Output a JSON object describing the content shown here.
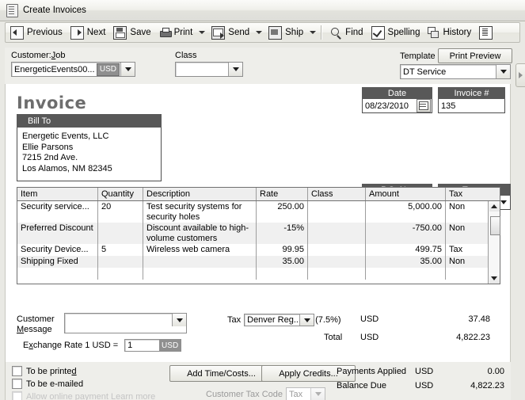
{
  "window": {
    "title": "Create Invoices",
    "title_icon": "invoice-document-icon"
  },
  "toolbar": {
    "items": [
      {
        "label": "Previous",
        "icon": "previous-arrow-icon",
        "has_dropdown": false
      },
      {
        "label": "Next",
        "icon": "next-arrow-icon",
        "has_dropdown": false
      },
      {
        "label": "Save",
        "icon": "floppy-disk-icon",
        "has_dropdown": false
      },
      {
        "label": "Print",
        "icon": "printer-icon",
        "has_dropdown": true
      },
      {
        "label": "Send",
        "icon": "envelope-send-icon",
        "has_dropdown": true
      },
      {
        "label": "Ship",
        "icon": "shipping-box-icon",
        "has_dropdown": true
      },
      {
        "label": "Find",
        "icon": "magnifier-icon",
        "has_dropdown": false
      },
      {
        "label": "Spelling",
        "icon": "spellcheck-icon",
        "has_dropdown": false
      },
      {
        "label": "History",
        "icon": "history-pages-icon",
        "has_dropdown": false
      },
      {
        "label": "",
        "icon": "letter-icon",
        "has_dropdown": false
      }
    ]
  },
  "header": {
    "customer_job_label": "Customer:Job",
    "customer_job_value": "EnergeticEvents00...",
    "customer_currency_chip": "USD",
    "class_label": "Class",
    "class_value": "",
    "template_label": "Template",
    "template_value": "DT Service",
    "print_preview_label": "Print Preview"
  },
  "invoice": {
    "title": "Invoice",
    "bill_to_label": "Bill To",
    "bill_to_lines": [
      "Energetic Events, LLC",
      "Ellie Parsons",
      "7215 2nd Ave.",
      "Los Alamos, NM 82345"
    ],
    "date_label": "Date",
    "date_value": "08/23/2010",
    "invoice_number_label": "Invoice #",
    "invoice_number_value": "135",
    "po_label": "P.O. No.",
    "po_value": "",
    "terms_label": "Terms",
    "terms_value": ""
  },
  "line_items": {
    "columns": [
      "Item",
      "Quantity",
      "Description",
      "Rate",
      "Class",
      "Amount",
      "Tax"
    ],
    "rows": [
      {
        "item": "Security service...",
        "quantity": "20",
        "description": "Test security systems for security holes",
        "rate": "250.00",
        "class": "",
        "amount": "5,000.00",
        "tax": "Non"
      },
      {
        "item": "Preferred Discount",
        "quantity": "",
        "description": "Discount available to high-volume customers",
        "rate": "-15%",
        "class": "",
        "amount": "-750.00",
        "tax": "Non"
      },
      {
        "item": "Security Device...",
        "quantity": "5",
        "description": "Wireless web camera",
        "rate": "99.95",
        "class": "",
        "amount": "499.75",
        "tax": "Tax"
      },
      {
        "item": "Shipping Fixed",
        "quantity": "",
        "description": "",
        "rate": "35.00",
        "class": "",
        "amount": "35.00",
        "tax": "Non"
      },
      {
        "item": "",
        "quantity": "",
        "description": "",
        "rate": "",
        "class": "",
        "amount": "",
        "tax": ""
      }
    ]
  },
  "totals": {
    "customer_message_label_line1": "Customer",
    "customer_message_label_line2": "Message",
    "customer_message_value": "",
    "tax_label": "Tax",
    "tax_value": "Denver Reg...",
    "tax_percent": "(7.5%)",
    "tax_currency": "USD",
    "tax_amount": "37.48",
    "total_label": "Total",
    "total_currency": "USD",
    "total_amount": "4,822.23",
    "exchange_rate_label": "Exchange Rate 1 USD =",
    "exchange_rate_value": "1",
    "exchange_rate_chip": "USD"
  },
  "footer": {
    "to_be_printed_label": "To be printed",
    "to_be_printed_checked": false,
    "to_be_emailed_label": "To be e-mailed",
    "to_be_emailed_checked": false,
    "allow_online_payment_label": "Allow online payment  Learn more",
    "add_time_costs_label": "Add Time/Costs...",
    "apply_credits_label": "Apply Credits...",
    "customer_tax_code_label": "Customer Tax Code",
    "customer_tax_code_value": "Tax",
    "payments_applied_label": "Payments Applied",
    "payments_applied_currency": "USD",
    "payments_applied_amount": "0.00",
    "balance_due_label": "Balance Due",
    "balance_due_currency": "USD",
    "balance_due_amount": "4,822.23"
  }
}
